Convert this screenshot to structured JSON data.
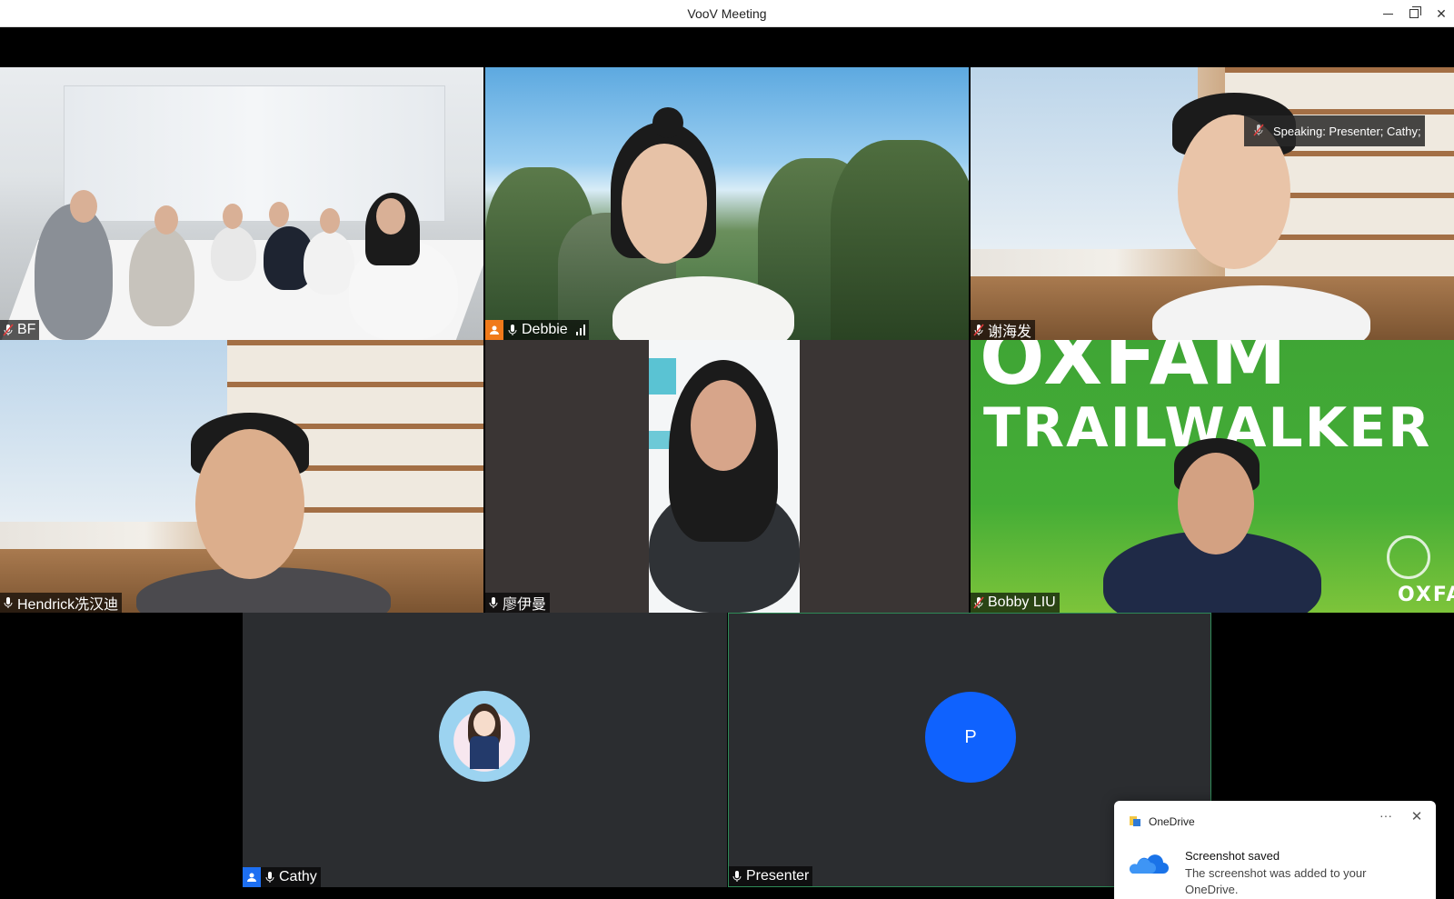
{
  "window": {
    "title": "VooV Meeting"
  },
  "speaking": {
    "text": "Speaking: Presenter; Cathy;"
  },
  "participants": [
    {
      "name": "BF",
      "mic": "muted"
    },
    {
      "name": "Debbie",
      "mic": "active",
      "host": true
    },
    {
      "name": "谢海发",
      "mic": "muted"
    },
    {
      "name": "Hendrick冼汉迪",
      "mic": "active"
    },
    {
      "name": "廖伊曼",
      "mic": "active"
    },
    {
      "name": "Bobby LIU",
      "mic": "muted"
    },
    {
      "name": "Cathy",
      "mic": "active",
      "host": true
    },
    {
      "name": "Presenter",
      "mic": "active",
      "avatar_letter": "P"
    }
  ],
  "backgrounds": {
    "oxfam_line1": "OXFAM",
    "oxfam_line2": "TRAILWALKER",
    "oxfam_corner": "OXFAM"
  },
  "toast": {
    "app": "OneDrive",
    "more": "···",
    "close": "✕",
    "heading": "Screenshot saved",
    "body": "The screenshot was added to your OneDrive."
  },
  "colors": {
    "host_orange": "#f07a1a",
    "host_blue": "#1d6ff2",
    "avatar_blue": "#0f62fe",
    "active_border": "#2e8a57"
  }
}
